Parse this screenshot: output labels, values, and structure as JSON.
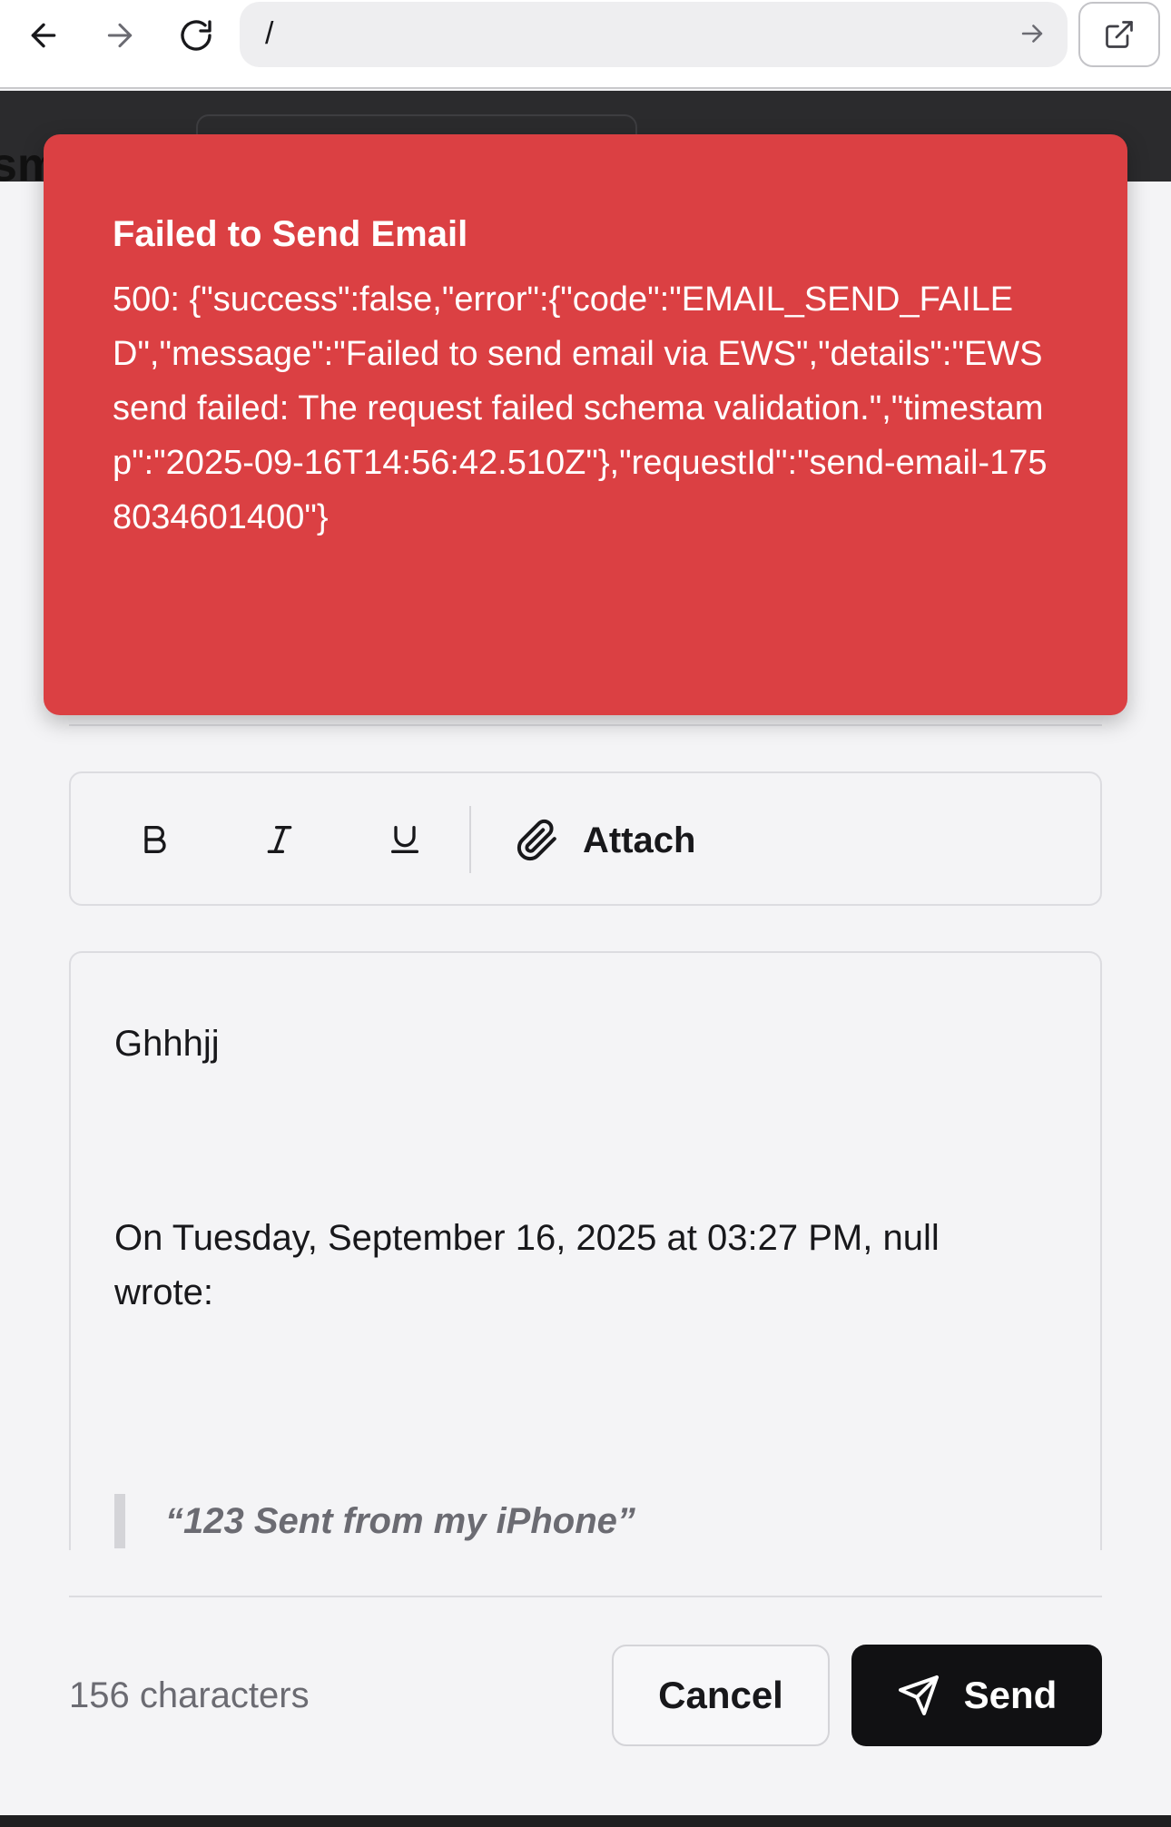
{
  "browser": {
    "url": "/"
  },
  "app_header": {
    "title_fragment": "sm"
  },
  "toast": {
    "title": "Failed to Send Email",
    "description": "500: {\"success\":false,\"error\":{\"code\":\"EMAIL_SEND_FAILED\",\"message\":\"Failed to send email via EWS\",\"details\":\"EWS send failed: The request failed schema validation.\",\"timestamp\":\"2025-09-16T14:56:42.510Z\"},\"requestId\":\"send-email-1758034601400\"}",
    "background": "#db4043"
  },
  "toolbar": {
    "bold_icon": "bold-icon",
    "italic_icon": "italic-icon",
    "underline_icon": "underline-icon",
    "attach_icon": "paperclip-icon",
    "attach_label": "Attach"
  },
  "editor": {
    "body": "Ghhhjj",
    "quote_header": "On Tuesday, September 16, 2025 at 03:27 PM, null wrote:",
    "quoted_text": "“123 Sent from my iPhone”"
  },
  "footer": {
    "char_count": "156 characters",
    "cancel_label": "Cancel",
    "send_label": "Send",
    "send_icon": "send-icon"
  }
}
